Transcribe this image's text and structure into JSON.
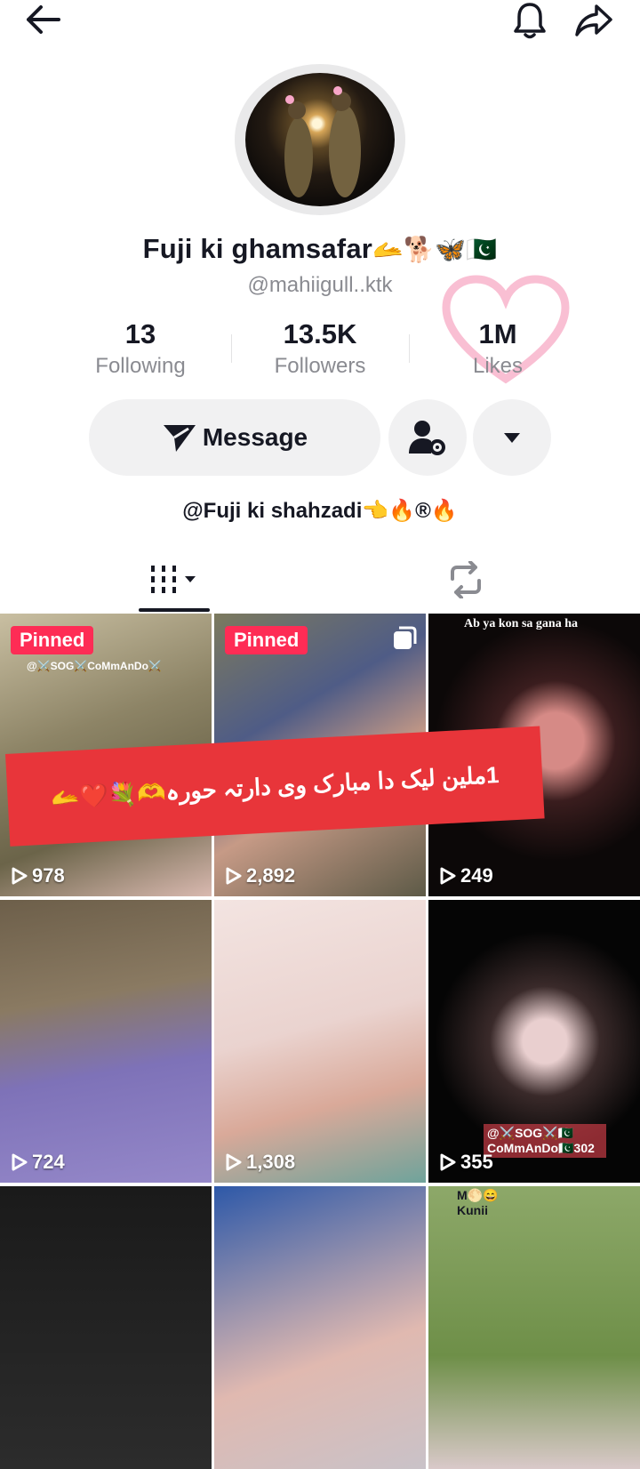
{
  "header": {
    "back_icon": "arrow-left-icon",
    "bell_icon": "bell-icon",
    "share_icon": "share-arrow-icon"
  },
  "profile": {
    "name": "Fuji ki ghamsafar",
    "name_emojis": "🫴🐕🦋🇵🇰",
    "handle": "@mahiigull..ktk",
    "bio": "@Fuji ki shahzadi👈🔥®🔥"
  },
  "stats": [
    {
      "value": "13",
      "label": "Following"
    },
    {
      "value": "13.5K",
      "label": "Followers"
    },
    {
      "value": "1M",
      "label": "Likes"
    }
  ],
  "actions": {
    "message_label": "Message"
  },
  "tabs": {
    "videos_icon": "grid-icon",
    "reposts_icon": "repost-icon"
  },
  "banner": {
    "text": "1ملین لیک دا مبارک وی دارتہ حورہ🫶💐❤️🫴"
  },
  "videos": [
    {
      "pinned": "Pinned",
      "views": "978",
      "overlay": "@⚔️SOG⚔️CoMmAnDo⚔️"
    },
    {
      "pinned": "Pinned",
      "views": "2,892",
      "overlay": ""
    },
    {
      "pinned": "",
      "views": "249",
      "overlay": "Ab ya kon sa gana ha"
    },
    {
      "pinned": "",
      "views": "724",
      "overlay": ""
    },
    {
      "pinned": "",
      "views": "1,308",
      "overlay": ""
    },
    {
      "pinned": "",
      "views": "355",
      "overlay": "@⚔️SOG⚔️🇵🇰 CoMmAnDo🇵🇰302"
    },
    {
      "pinned": "",
      "views": "",
      "overlay": ""
    },
    {
      "pinned": "",
      "views": "",
      "overlay": ""
    },
    {
      "pinned": "",
      "views": "",
      "overlay": "M🌕😄 Kunii"
    }
  ],
  "colors": {
    "accent": "#fe2c55",
    "banner": "#e8353a",
    "muted_text": "#8a8b91"
  }
}
